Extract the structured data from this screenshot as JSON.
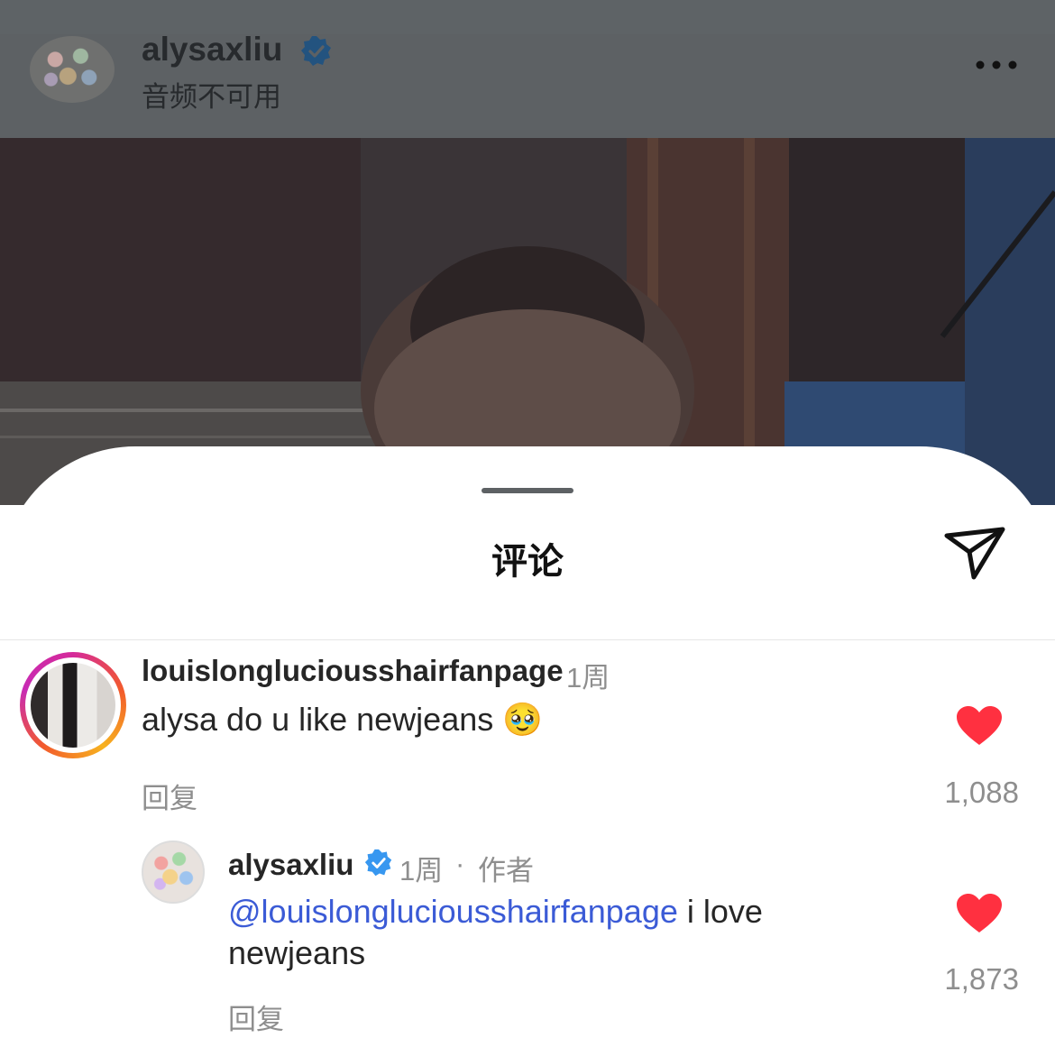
{
  "post_header": {
    "username": "alysaxliu",
    "subtitle": "音频不可用"
  },
  "comments_sheet": {
    "title": "评论"
  },
  "comments": [
    {
      "username": "louislongluciousshairfanpage",
      "time": "1周",
      "text": "alysa do u like newjeans",
      "emoji": "🥹",
      "reply_label": "回复",
      "likes": "1,088"
    }
  ],
  "replies": [
    {
      "username": "alysaxliu",
      "time": "1周",
      "separator": "·",
      "author_badge": "作者",
      "mention": "@louislongluciousshairfanpage",
      "text_line1": " i love",
      "text_line2": "newjeans",
      "reply_label": "回复",
      "likes": "1,873"
    }
  ],
  "icons": {
    "verified": "verified-badge-icon",
    "more": "more-horizontal-icon",
    "share": "paper-plane-icon",
    "like": "heart-icon"
  },
  "colors": {
    "verified": "#3797f0",
    "heart": "#ff3040",
    "mention": "#3b5bd6"
  }
}
